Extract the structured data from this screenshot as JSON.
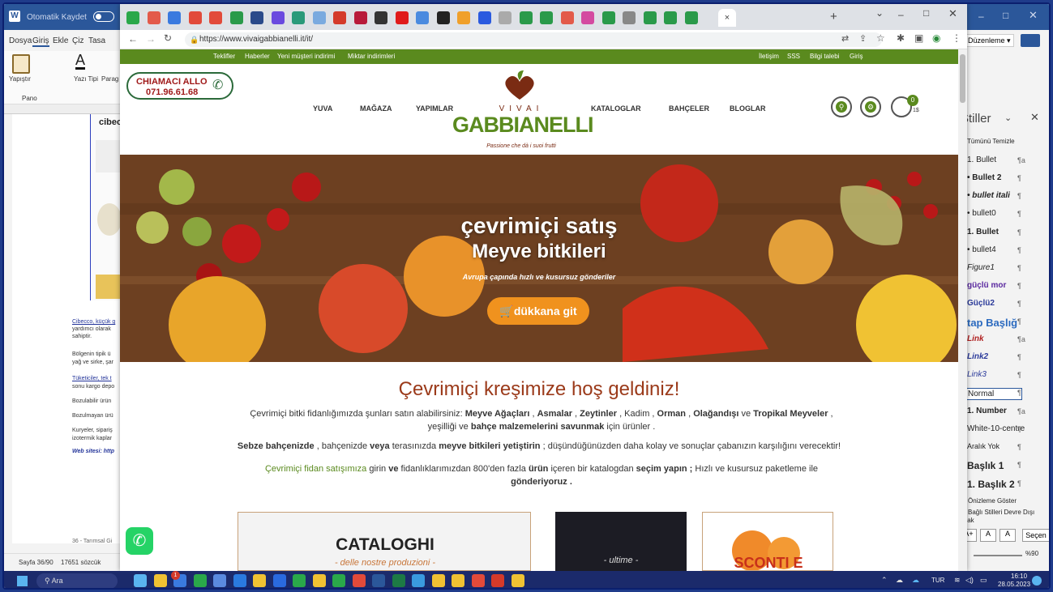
{
  "word": {
    "autosave_label": "Otomatik Kaydet",
    "menu": [
      "Dosya",
      "Giriş",
      "Ekle",
      "Çiz",
      "Tasa"
    ],
    "ribbon": {
      "paste": "Yapıştır",
      "font": "Yazı Tipi",
      "paragraph": "Parag",
      "clipboard": "Pano"
    },
    "page_heading": "cibec",
    "page_lines": [
      "Cibecco, küçük g",
      "yardımcı olarak",
      "sahiptir.",
      "Bölgenin tipik ü",
      "yağ ve sirke, şar",
      "Tüketiciler, tek t",
      "sonu kargo depo",
      "Bozulabilir ürün",
      "Bozulmayan ürü",
      "Kuryeler, sipariş",
      "izotermik kaplar",
      "Web sitesi: http"
    ],
    "footer_text": "36 - Tarımsal Gi",
    "status": {
      "page": "Sayfa 36/90",
      "words": "17651 sözcük"
    }
  },
  "styles_pane": {
    "toolbar_label": "Düzenleme",
    "title": "Stiller",
    "items": [
      {
        "label": "Tümünü Temizle",
        "mark": ""
      },
      {
        "label": "1. Bullet",
        "mark": "¶a"
      },
      {
        "label": "• Bullet 2",
        "mark": "¶"
      },
      {
        "label": "• bullet itali",
        "mark": "¶"
      },
      {
        "label": "• bullet0",
        "mark": "¶"
      },
      {
        "label": "1. Bullet",
        "mark": "¶"
      },
      {
        "label": "• bullet4",
        "mark": "¶"
      },
      {
        "label": "Figure1",
        "mark": "¶"
      },
      {
        "label": "güçlü mor",
        "mark": "¶"
      },
      {
        "label": "Güçlü2",
        "mark": "¶"
      },
      {
        "label": "tap Başlığ",
        "mark": "¶"
      },
      {
        "label": "Link",
        "mark": "¶a"
      },
      {
        "label": "Link2",
        "mark": "¶"
      },
      {
        "label": "Link3",
        "mark": "¶"
      },
      {
        "label": "Normal",
        "mark": "¶"
      },
      {
        "label": "1. Number",
        "mark": "¶a"
      },
      {
        "label": "White-10-centre",
        "mark": "¶"
      },
      {
        "label": "Aralık Yok",
        "mark": "¶"
      },
      {
        "label": "Başlık 1",
        "mark": "¶"
      },
      {
        "label": "1. Başlık 2",
        "mark": "¶"
      }
    ],
    "preview_label": "Önizleme Göster",
    "linked_label": "Bağlı Stilleri Devre Dışı Bırak",
    "select_button": "Seçen",
    "zoom": "%90"
  },
  "browser": {
    "url": "https://www.vivaigabbianelli.it/it/",
    "close_tab_label": "×",
    "new_tab_label": "+"
  },
  "site": {
    "topbar_left": [
      "Teklifler",
      "Haberler",
      "Yeni müşteri indirimi",
      "Miktar indirimleri"
    ],
    "topbar_right": [
      "İletişim",
      "SSS",
      "Bilgi talebi",
      "Giriş"
    ],
    "callus_label": "CHIAMACI ALLO",
    "callus_number": "071.96.61.68",
    "nav": [
      "YUVA",
      "MAĞAZA",
      "YAPIMLAR",
      "KATALOGLAR",
      "BAHÇELER",
      "BLOGLAR"
    ],
    "logo_top": "VIVAI",
    "logo_main": "GABBIANELLI",
    "logo_tagline": "Passione che dà i suoi frutti",
    "cart_count": "0",
    "cart_price": "1$",
    "hero_title": "çevrimiçi satış",
    "hero_subtitle": "Meyve bitkileri",
    "hero_tagline": "Avrupa çapında hızlı ve kusursuz gönderiler",
    "hero_button": "dükkana git",
    "welcome_title": "Çevrimiçi kreşimize hoş geldiniz!",
    "p1_a": "Çevrimiçi bitki fidanlığımızda şunları satın alabilirsiniz: ",
    "p1_b": "Meyve Ağaçları",
    "p1_c": " , ",
    "p1_d": "Asmalar",
    "p1_e": " , ",
    "p1_f": "Zeytinler",
    "p1_g": " , Kadim , ",
    "p1_h": "Orman",
    "p1_i": " , ",
    "p1_j": "Olağandışı",
    "p1_k": " ve ",
    "p1_l": "Tropikal Meyveler",
    "p1_m": " ,",
    "p1_line2_a": "yeşilliği ve ",
    "p1_line2_b": "bahçe malzemelerini savunmak",
    "p1_line2_c": " için ürünler .",
    "p2_a": "Sebze bahçenizde",
    "p2_b": " , bahçenizde ",
    "p2_c": "veya",
    "p2_d": " terasınızda ",
    "p2_e": "meyve bitkileri yetiştirin",
    "p2_f": " ; düşündüğünüzden daha kolay ve sonuçlar çabanızın karşılığını verecektir!",
    "p3_link": "Çevrimiçi fidan satışımıza",
    "p3_a": " girin ",
    "p3_b": "ve",
    "p3_c": " fidanlıklarımızdan 800'den fazla ",
    "p3_d": "ürün",
    "p3_e": " içeren bir katalogdan ",
    "p3_f": "seçim yapın ;",
    "p3_g": " Hızlı ve kusursuz paketleme ile",
    "p3_line2": "gönderiyoruz .",
    "card1_title": "CATALOGHI",
    "card1_sub": "- delle nostre produzioni -",
    "card2_sub": "- ultime -",
    "card3_title": "SCONTI E"
  },
  "taskbar": {
    "search": "Ara",
    "lang": "TUR",
    "time": "16:10",
    "date": "28.05.2023",
    "badge": "1"
  },
  "colors": {
    "green": "#5a8a1e",
    "brown": "#7a2b13",
    "orange": "#f0921e",
    "taskbar": "#1b2a6b"
  }
}
